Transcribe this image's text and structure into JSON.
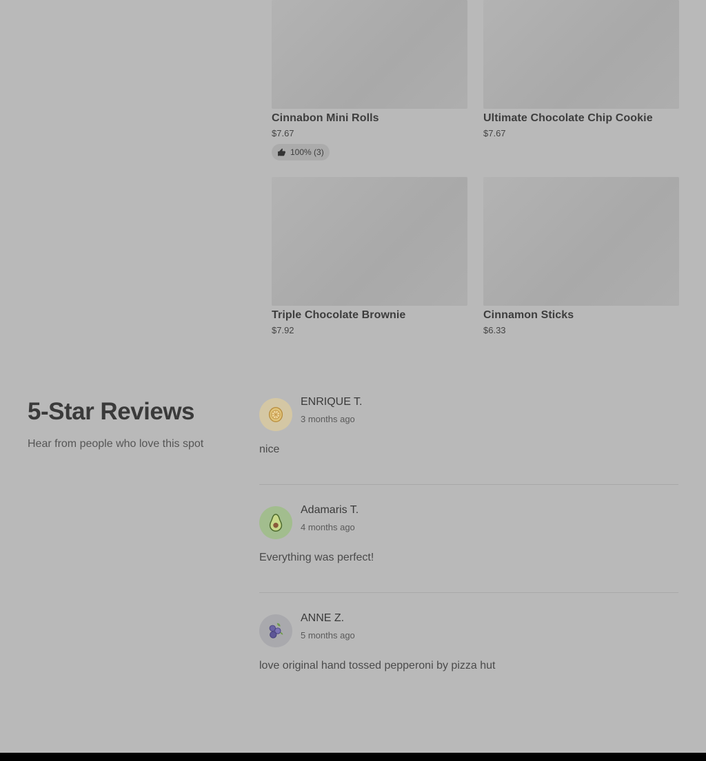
{
  "menu_items": [
    {
      "name": "Cinnabon Mini Rolls",
      "price": "$7.67",
      "rating": "100% (3)"
    },
    {
      "name": "Ultimate Chocolate Chip Cookie",
      "price": "$7.67"
    },
    {
      "name": "Triple Chocolate Brownie",
      "price": "$7.92"
    },
    {
      "name": "Cinnamon Sticks",
      "price": "$6.33"
    }
  ],
  "reviews_section": {
    "title": "5-Star Reviews",
    "subtitle": "Hear from people who love this spot"
  },
  "reviews": [
    {
      "name": "ENRIQUE T.",
      "date": "3 months ago",
      "text": "nice",
      "avatar": "lemon-icon",
      "avatar_color": "#d4c7a4"
    },
    {
      "name": "Adamaris T.",
      "date": "4 months ago",
      "text": "Everything was perfect!",
      "avatar": "avocado-icon",
      "avatar_color": "#a2bd8e"
    },
    {
      "name": "ANNE Z.",
      "date": "5 months ago",
      "text": "love original hand tossed pepperoni by pizza hut",
      "avatar": "blueberry-icon",
      "avatar_color": "#a9a9ad"
    }
  ],
  "colors": {
    "overlay_background": "#b9b9b9",
    "footer": "#000000"
  }
}
